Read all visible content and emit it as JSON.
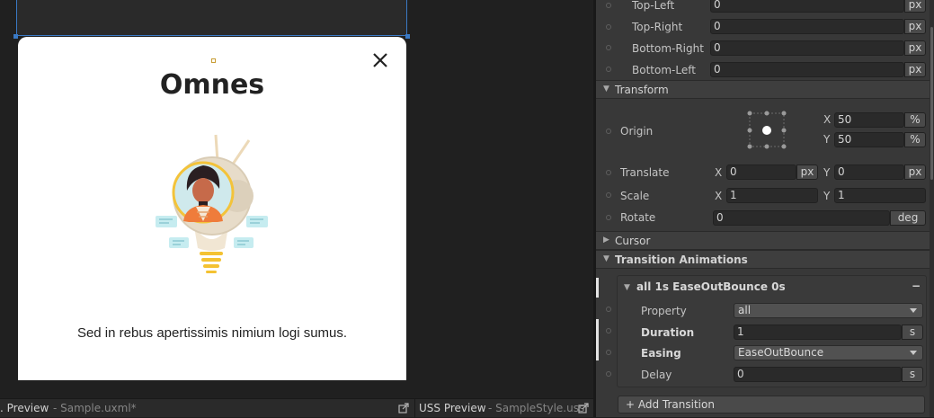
{
  "preview": {
    "card_title": "Omnes",
    "card_text": "Sed in rebus apertissimis nimium logi sumus."
  },
  "bottom_tabs": [
    {
      "title": ". Preview",
      "file": "- Sample.uxml*"
    },
    {
      "title": "USS Preview",
      "file": "- SampleStyle.uss"
    }
  ],
  "inspector": {
    "border_radius": [
      {
        "label": "Top-Left",
        "value": "0",
        "unit": "px"
      },
      {
        "label": "Top-Right",
        "value": "0",
        "unit": "px"
      },
      {
        "label": "Bottom-Right",
        "value": "0",
        "unit": "px"
      },
      {
        "label": "Bottom-Left",
        "value": "0",
        "unit": "px"
      }
    ],
    "transform": {
      "header": "Transform",
      "origin": {
        "label": "Origin",
        "x_axis": "X",
        "x_value": "50",
        "x_unit": "%",
        "y_axis": "Y",
        "y_value": "50",
        "y_unit": "%"
      },
      "translate": {
        "label": "Translate",
        "x_axis": "X",
        "x_value": "0",
        "x_unit": "px",
        "y_axis": "Y",
        "y_value": "0",
        "y_unit": "px"
      },
      "scale": {
        "label": "Scale",
        "x_axis": "X",
        "x_value": "1",
        "y_axis": "Y",
        "y_value": "1"
      },
      "rotate": {
        "label": "Rotate",
        "value": "0",
        "unit": "deg"
      }
    },
    "cursor": {
      "header": "Cursor"
    },
    "transition_animations": {
      "header": "Transition Animations",
      "item": {
        "header": "all 1s EaseOutBounce 0s",
        "remove_label": "−",
        "property": {
          "label": "Property",
          "value": "all"
        },
        "duration": {
          "label": "Duration",
          "value": "1",
          "unit": "s"
        },
        "easing": {
          "label": "Easing",
          "value": "EaseOutBounce"
        },
        "delay": {
          "label": "Delay",
          "value": "0",
          "unit": "s"
        }
      },
      "add_label": "+ Add Transition"
    }
  },
  "colors": {
    "selection_blue": "#3a79c4",
    "panel_bg": "#383838",
    "field_bg": "#2a2a2a"
  }
}
